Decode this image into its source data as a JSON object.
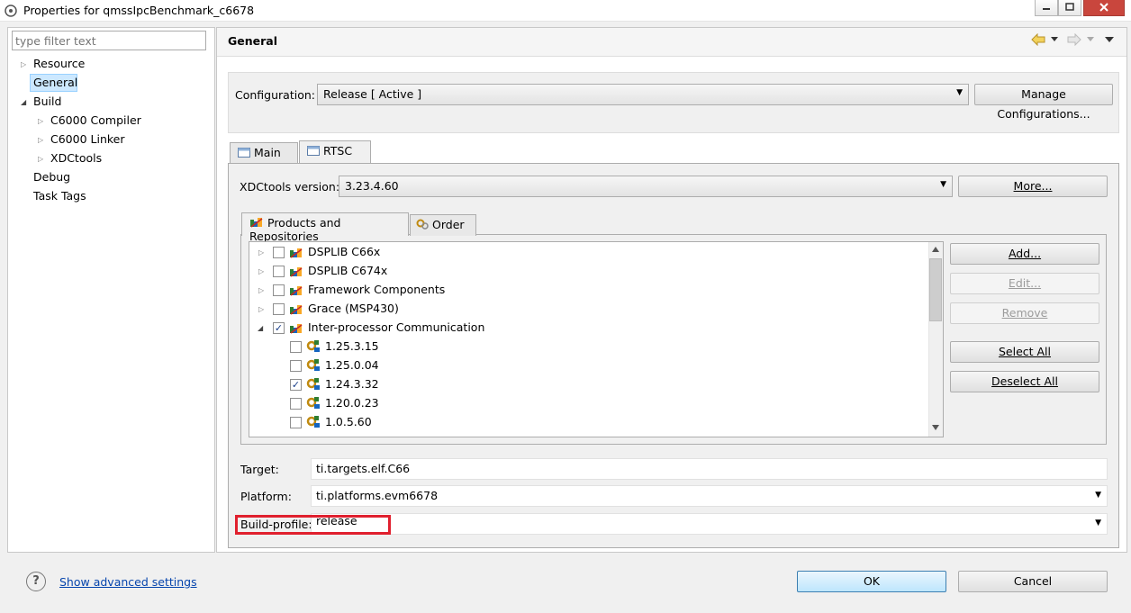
{
  "window": {
    "title": "Properties for qmssIpcBenchmark_c6678"
  },
  "left": {
    "filter_placeholder": "type filter text",
    "tree": [
      {
        "label": "Resource"
      },
      {
        "label": "General"
      },
      {
        "label": "Build"
      },
      {
        "label": "C6000 Compiler"
      },
      {
        "label": "C6000 Linker"
      },
      {
        "label": "XDCtools"
      },
      {
        "label": "Debug"
      },
      {
        "label": "Task Tags"
      }
    ]
  },
  "page": {
    "title": "General",
    "configuration_label": "Configuration:",
    "configuration_value": "Release  [ Active ]",
    "manage_button": "Manage Configurations...",
    "tabs": [
      "Main",
      "RTSC"
    ],
    "xdc_label": "XDCtools version:",
    "xdc_value": "3.23.4.60",
    "more_button": "More...",
    "subtabs": [
      "Products and Repositories",
      "Order"
    ],
    "products": [
      {
        "label": "DSPLIB C66x",
        "checked": false
      },
      {
        "label": "DSPLIB C674x",
        "checked": false
      },
      {
        "label": "Framework Components",
        "checked": false
      },
      {
        "label": "Grace (MSP430)",
        "checked": false
      },
      {
        "label": "Inter-processor Communication",
        "checked": true
      }
    ],
    "versions": [
      {
        "label": "1.25.3.15",
        "checked": false
      },
      {
        "label": "1.25.0.04",
        "checked": false
      },
      {
        "label": "1.24.3.32",
        "checked": true
      },
      {
        "label": "1.20.0.23",
        "checked": false
      },
      {
        "label": "1.0.5.60",
        "checked": false
      }
    ],
    "buttons": {
      "add": "Add...",
      "edit": "Edit...",
      "remove": "Remove",
      "select_all": "Select All",
      "deselect_all": "Deselect All"
    },
    "target_label": "Target:",
    "target_value": "ti.targets.elf.C66",
    "platform_label": "Platform:",
    "platform_value": "ti.platforms.evm6678",
    "build_profile_label": "Build-profile:",
    "build_profile_value": "release"
  },
  "bottom": {
    "advanced_link": "Show advanced settings",
    "ok": "OK",
    "cancel": "Cancel"
  },
  "colors": {
    "highlight_box": "#e0202e",
    "selection": "#cce8ff",
    "link": "#0645ad"
  }
}
